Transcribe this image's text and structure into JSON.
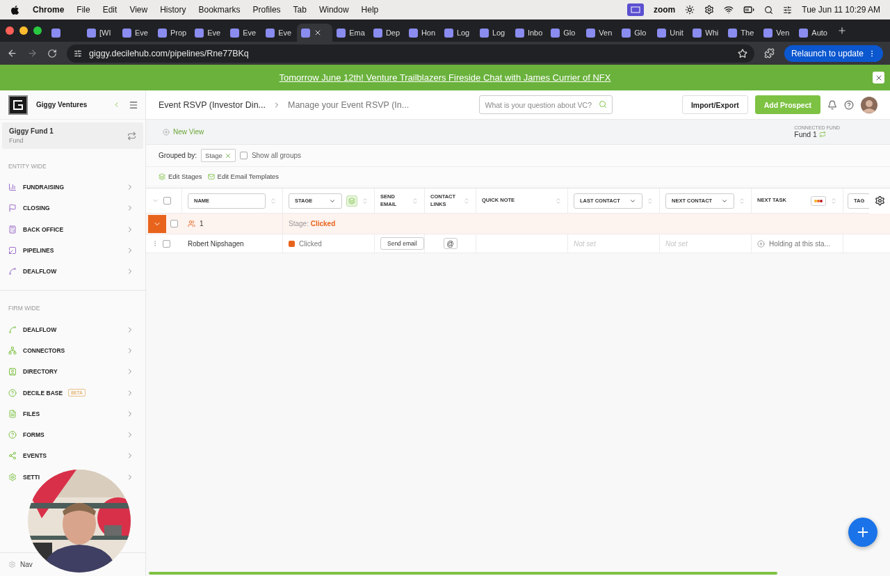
{
  "menu_bar": {
    "app": "Chrome",
    "menus": [
      "File",
      "Edit",
      "View",
      "History",
      "Bookmarks",
      "Profiles",
      "Tab",
      "Window",
      "Help"
    ],
    "zoom_label": "zoom",
    "clock": "Tue Jun 11  10:29 AM"
  },
  "browser_tabs": [
    {
      "selected": false
    },
    {
      "label": "[WI",
      "selected": false
    },
    {
      "label": "Eve",
      "selected": false
    },
    {
      "label": "Prop",
      "selected": false
    },
    {
      "label": "Eve",
      "selected": false
    },
    {
      "label": "Eve",
      "selected": false
    },
    {
      "label": "Eve",
      "selected": false
    },
    {
      "selected": true
    },
    {
      "label": "Ema",
      "selected": false
    },
    {
      "label": "Dep",
      "selected": false
    },
    {
      "label": "Hon",
      "selected": false
    },
    {
      "label": "Log",
      "selected": false
    },
    {
      "label": "Log",
      "selected": false
    },
    {
      "label": "Inbo",
      "selected": false
    },
    {
      "label": "Glo",
      "selected": false
    },
    {
      "label": "Ven",
      "selected": false
    },
    {
      "label": "Glo",
      "selected": false
    },
    {
      "label": "Unit",
      "selected": false
    },
    {
      "label": "Whi",
      "selected": false
    },
    {
      "label": "The",
      "selected": false
    },
    {
      "label": "Ven",
      "selected": false
    },
    {
      "label": "Auto",
      "selected": false
    }
  ],
  "address_bar": {
    "url": "giggy.decilehub.com/pipelines/Rne77BKq",
    "relaunch_button": "Relaunch to update"
  },
  "banner": {
    "text": "Tomorrow June 12th! Venture Trailblazers Fireside Chat with James Currier of NFX"
  },
  "sidebar": {
    "org_name": "Giggy Ventures",
    "fund": {
      "name": "Giggy Fund 1",
      "type": "Fund"
    },
    "sections": [
      {
        "title": "ENTITY WIDE",
        "items": [
          {
            "label": "FUNDRAISING"
          },
          {
            "label": "CLOSING"
          },
          {
            "label": "BACK OFFICE"
          },
          {
            "label": "PIPELINES"
          },
          {
            "label": "DEALFLOW"
          }
        ]
      },
      {
        "title": "FIRM WIDE",
        "items": [
          {
            "label": "DEALFLOW"
          },
          {
            "label": "CONNECTORS"
          },
          {
            "label": "DIRECTORY"
          },
          {
            "label": "DECILE BASE",
            "badge": "BETA"
          },
          {
            "label": "FILES"
          },
          {
            "label": "FORMS"
          },
          {
            "label": "EVENTS"
          },
          {
            "label": "SETTI"
          }
        ]
      }
    ],
    "footer": "Nav"
  },
  "header": {
    "breadcrumb": [
      "Event RSVP (Investor Din...",
      "Manage your Event RSVP (In..."
    ],
    "search": {
      "placeholder": "What is your question about VC?"
    },
    "buttons": [
      {
        "label": "Import/Export",
        "kind": "secondary"
      },
      {
        "label": "Add Prospect",
        "kind": "primary"
      }
    ]
  },
  "view_bar": {
    "new_view": "New View",
    "connected_fund_label": "CONNECTED FUND",
    "connected_fund": "Fund 1"
  },
  "grouping": {
    "label": "Grouped by:",
    "chip": "Stage",
    "show_all_groups": {
      "label": "Show all groups",
      "checked": false
    }
  },
  "actions": [
    "Edit Stages",
    "Edit Email Templates"
  ],
  "table": {
    "select_all_checked": false,
    "columns": [
      {
        "label": "NAME",
        "kind": "field"
      },
      {
        "label": "STAGE",
        "kind": "dropdown"
      },
      {
        "label": "SEND EMAIL",
        "kind": "plain"
      },
      {
        "label": "CONTACT LINKS",
        "kind": "plain"
      },
      {
        "label": "QUICK NOTE",
        "kind": "plain"
      },
      {
        "label": "LAST CONTACT",
        "kind": "dropdown"
      },
      {
        "label": "NEXT CONTACT",
        "kind": "dropdown"
      },
      {
        "label": "NEXT TASK",
        "kind": "plain"
      },
      {
        "label": "TAG",
        "kind": "field"
      }
    ],
    "groups": [
      {
        "count": "1",
        "stage_label": "Stage:",
        "stage": "Clicked",
        "expanded": true,
        "checked": false,
        "rows": [
          {
            "name": "Robert Nipshagen",
            "stage": "Clicked",
            "send_email": "Send email",
            "contact_links": "@",
            "last_contact": "Not set",
            "next_contact": "Not set",
            "next_task": "Holding at this sta...",
            "checked": false
          }
        ]
      }
    ]
  }
}
